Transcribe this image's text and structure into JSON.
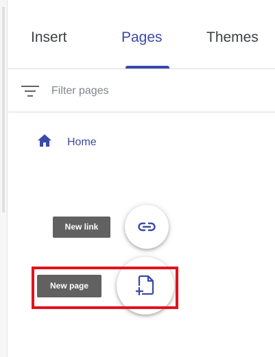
{
  "tabs": [
    {
      "label": "Insert",
      "active": false
    },
    {
      "label": "Pages",
      "active": true
    },
    {
      "label": "Themes",
      "active": false
    }
  ],
  "filter": {
    "placeholder": "Filter pages",
    "value": "",
    "icon": "filter-icon"
  },
  "pages": {
    "items": [
      {
        "label": "Home",
        "icon": "home-icon"
      }
    ]
  },
  "actions": {
    "new_link": {
      "tooltip": "New link",
      "icon": "link-icon"
    },
    "new_page": {
      "tooltip": "New page",
      "icon": "add-page-icon"
    }
  },
  "colors": {
    "accent": "#3949ab",
    "highlight": "#e3121b",
    "tooltip_bg": "#616161"
  }
}
